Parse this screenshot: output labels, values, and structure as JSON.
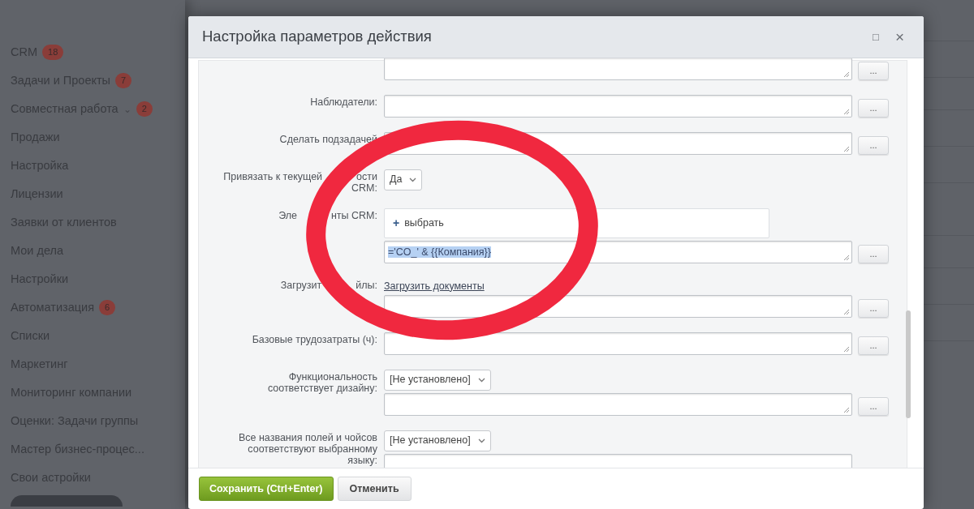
{
  "sidebar": {
    "items": [
      {
        "label": "CRM",
        "badge": "18"
      },
      {
        "label": "Задачи и Проекты",
        "badge": "7"
      },
      {
        "label": "Совместная работа",
        "chevron": "⌄",
        "badge": "2"
      },
      {
        "label": "Продажи"
      },
      {
        "label": "Настройка"
      },
      {
        "label": "Лицензии"
      },
      {
        "label": "Заявки от клиентов"
      },
      {
        "label": "Мои дела"
      },
      {
        "label": "Настройки"
      },
      {
        "label": "Автоматизация",
        "badge": "6"
      },
      {
        "label": "Списки"
      },
      {
        "label": "Маркетинг"
      },
      {
        "label": "Мониторинг компании"
      },
      {
        "label": "Оценки: Задачи группы"
      },
      {
        "label": "Мастер бизнес-процес..."
      },
      {
        "label": "Свои астройки"
      }
    ]
  },
  "dialog": {
    "title": "Настройка параметров действия",
    "controls": [
      {
        "kind": "maximize",
        "glyph": "□"
      },
      {
        "kind": "close",
        "glyph": "×"
      }
    ],
    "fields": [
      {
        "controls": [
          {
            "kind": "textarea",
            "more": "..."
          }
        ]
      },
      {
        "label_lines": [
          [
            "Наблюдатели:"
          ]
        ],
        "controls": [
          {
            "kind": "textarea",
            "more": "..."
          }
        ]
      },
      {
        "label_lines": [
          [
            "Сделать подзадачей"
          ]
        ],
        "controls": [
          {
            "kind": "textarea",
            "more": "..."
          }
        ]
      },
      {
        "label_lines": [
          [
            "Привязать к текущей",
            "ости"
          ],
          [
            "CRM:"
          ]
        ],
        "controls": [
          {
            "kind": "select",
            "value": "Да"
          }
        ]
      },
      {
        "label_lines": [
          [
            "Эле",
            "нты CRM:"
          ]
        ],
        "controls": [
          {
            "kind": "picker",
            "plus": "+",
            "action": "выбрать"
          },
          {
            "kind": "textarea",
            "value": "='CO_' & {{Компания}}",
            "highlighted": true,
            "more": "..."
          }
        ]
      },
      {
        "label_lines": [
          [
            "Загрузит",
            "йлы:"
          ]
        ],
        "controls": [
          {
            "kind": "link",
            "text": "Загрузить документы"
          },
          {
            "kind": "textarea",
            "more": "..."
          }
        ]
      },
      {
        "label_lines": [
          [
            "Базовые трудозатраты (ч):"
          ]
        ],
        "controls": [
          {
            "kind": "textarea",
            "more": "..."
          }
        ]
      },
      {
        "label_lines": [
          [
            "Функциональность"
          ],
          [
            "соответствует дизайну:"
          ]
        ],
        "controls": [
          {
            "kind": "select",
            "value": "[Не установлено]"
          },
          {
            "kind": "textarea",
            "more": "..."
          }
        ]
      },
      {
        "label_lines": [
          [
            "Все названия полей и чойсов"
          ],
          [
            "соответствуют выбранному"
          ],
          [
            "языку:"
          ]
        ],
        "controls": [
          {
            "kind": "select",
            "value": "[Не установлено]"
          },
          {
            "kind": "textarea"
          }
        ]
      }
    ],
    "buttons": [
      {
        "label": "Сохранить (Ctrl+Enter)",
        "kind": "primary"
      },
      {
        "label": "Отменить",
        "kind": "secondary"
      }
    ]
  },
  "annotations": [
    {
      "kind": "ellipse"
    }
  ]
}
